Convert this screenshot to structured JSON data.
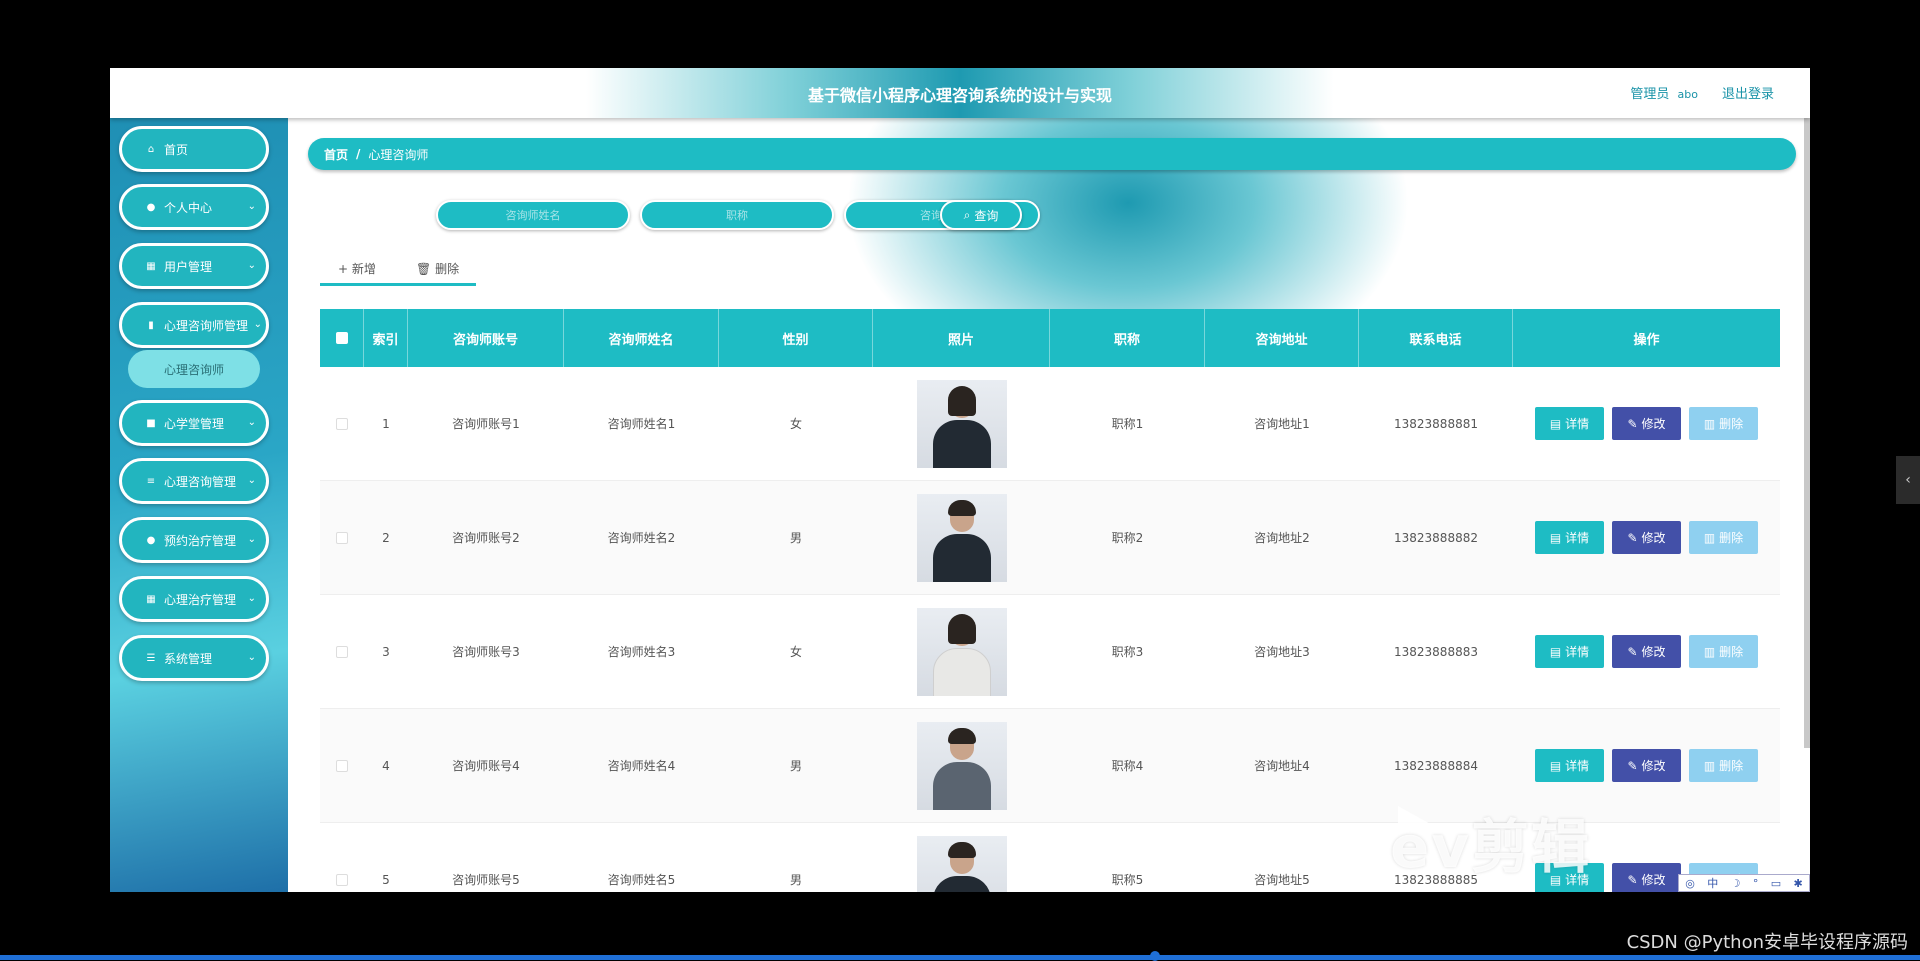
{
  "header": {
    "title": "基于微信小程序心理咨询系统的设计与实现",
    "user_role": "管理员",
    "user_name": "abo",
    "logout_label": "退出登录"
  },
  "sidebar": {
    "items": [
      {
        "label": "首页",
        "icon": "home-icon"
      },
      {
        "label": "个人中心",
        "icon": "user-icon"
      },
      {
        "label": "用户管理",
        "icon": "grid-icon"
      },
      {
        "label": "心理咨询师管理",
        "icon": "chart-icon"
      },
      {
        "label": "心学堂管理",
        "icon": "clipboard-icon"
      },
      {
        "label": "心理咨询管理",
        "icon": "list-icon"
      },
      {
        "label": "预约治疗管理",
        "icon": "user-icon"
      },
      {
        "label": "心理治疗管理",
        "icon": "grid-icon"
      },
      {
        "label": "系统管理",
        "icon": "sliders-icon"
      }
    ],
    "active_sub": "心理咨询师"
  },
  "breadcrumb": {
    "home": "首页",
    "separator": "/",
    "current": "心理咨询师"
  },
  "search": {
    "name_placeholder": "咨询师姓名",
    "title_placeholder": "职称",
    "address_placeholder": "咨询地址",
    "button_label": "查询"
  },
  "toolbar": {
    "add_label": "新增",
    "delete_label": "删除"
  },
  "table": {
    "columns": [
      "索引",
      "咨询师账号",
      "咨询师姓名",
      "性别",
      "照片",
      "职称",
      "咨询地址",
      "联系电话",
      "操作"
    ],
    "rows": [
      {
        "index": "1",
        "account": "咨询师账号1",
        "name": "咨询师姓名1",
        "sex": "女",
        "title": "职称1",
        "address": "咨询地址1",
        "phone": "13823888881"
      },
      {
        "index": "2",
        "account": "咨询师账号2",
        "name": "咨询师姓名2",
        "sex": "男",
        "title": "职称2",
        "address": "咨询地址2",
        "phone": "13823888882"
      },
      {
        "index": "3",
        "account": "咨询师账号3",
        "name": "咨询师姓名3",
        "sex": "女",
        "title": "职称3",
        "address": "咨询地址3",
        "phone": "13823888883"
      },
      {
        "index": "4",
        "account": "咨询师账号4",
        "name": "咨询师姓名4",
        "sex": "男",
        "title": "职称4",
        "address": "咨询地址4",
        "phone": "13823888884"
      },
      {
        "index": "5",
        "account": "咨询师账号5",
        "name": "咨询师姓名5",
        "sex": "男",
        "title": "职称5",
        "address": "咨询地址5",
        "phone": "13823888885"
      }
    ],
    "actions": {
      "detail": "详情",
      "edit": "修改",
      "delete": "删除"
    }
  },
  "colors": {
    "accent": "#1ebcc4",
    "edit": "#4350a8",
    "delete": "#8fd0f0"
  },
  "overlay": {
    "watermark": "ev剪辑",
    "credit": "CSDN @Python安卓毕设程序源码",
    "ime_label": "中"
  }
}
